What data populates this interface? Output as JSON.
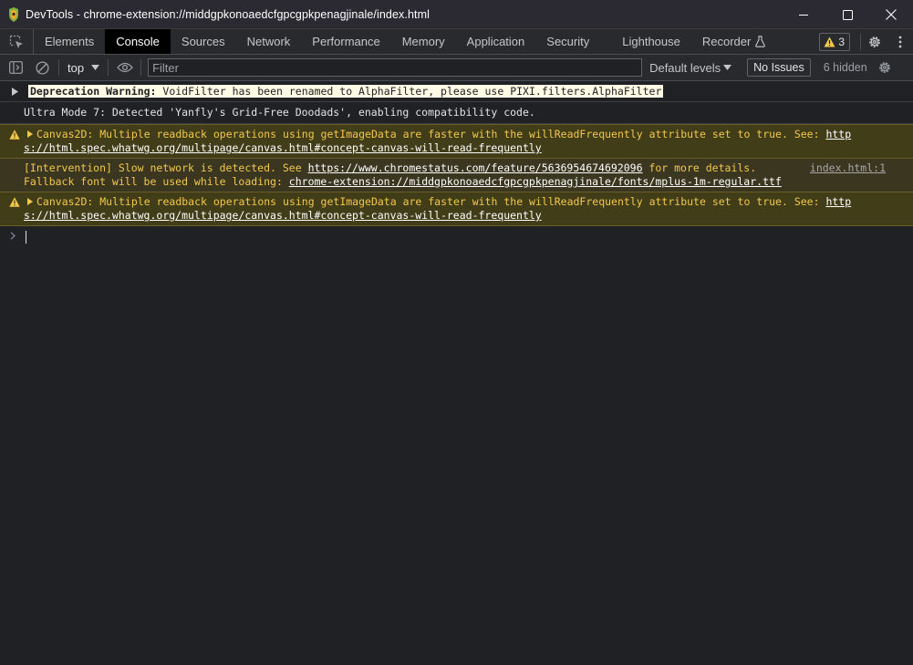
{
  "window": {
    "title": "DevTools - chrome-extension://middgpkonoaedcfgpcgpkpenagjinale/index.html",
    "app_icon": "devtools-app-icon",
    "controls": [
      "minimize-icon",
      "maximize-icon",
      "close-icon"
    ]
  },
  "tabs": {
    "items": [
      {
        "label": "Elements",
        "active": false
      },
      {
        "label": "Console",
        "active": true
      },
      {
        "label": "Sources",
        "active": false
      },
      {
        "label": "Network",
        "active": false
      },
      {
        "label": "Performance",
        "active": false
      },
      {
        "label": "Memory",
        "active": false
      },
      {
        "label": "Application",
        "active": false
      },
      {
        "label": "Security",
        "active": false
      },
      {
        "label": "Lighthouse",
        "active": false
      },
      {
        "label": "Recorder",
        "active": false
      }
    ],
    "issues_count": "3",
    "colors": {
      "warning": "#f2c84b",
      "active_tab_bg": "#000000"
    }
  },
  "toolbar": {
    "context": "top",
    "filter_placeholder": "Filter",
    "levels": "Default levels",
    "no_issues": "No Issues",
    "hidden": "6 hidden"
  },
  "console": {
    "messages": [
      {
        "type": "deprecation",
        "label": "Deprecation Warning:",
        "text": " VoidFilter has been renamed to AlphaFilter, please use PIXI.filters.AlphaFilter"
      },
      {
        "type": "info",
        "text": "Ultra Mode 7: Detected 'Yanfly's Grid-Free Doodads', enabling compatibility code."
      },
      {
        "type": "warn",
        "text": "Canvas2D: Multiple readback operations using getImageData are faster with the willReadFrequently attribute set to true. See: ",
        "link_a": "http",
        "link_b": "s://html.spec.whatwg.org/multipage/canvas.html#concept-canvas-will-read-frequently"
      },
      {
        "type": "intervention",
        "text_a": "[Intervention] Slow network is detected. See ",
        "link": "https://www.chromestatus.com/feature/5636954674692096",
        "text_b": " for more details.",
        "text_c": "Fallback font will be used while loading: ",
        "font_link": "chrome-extension://middgpkonoaedcfgpcgpkpenagjinale/fonts/mplus-1m-regular.ttf",
        "source": "index.html:1"
      },
      {
        "type": "warn",
        "text": "Canvas2D: Multiple readback operations using getImageData are faster with the willReadFrequently attribute set to true. See: ",
        "link_a": "http",
        "link_b": "s://html.spec.whatwg.org/multipage/canvas.html#concept-canvas-will-read-frequently"
      }
    ]
  }
}
